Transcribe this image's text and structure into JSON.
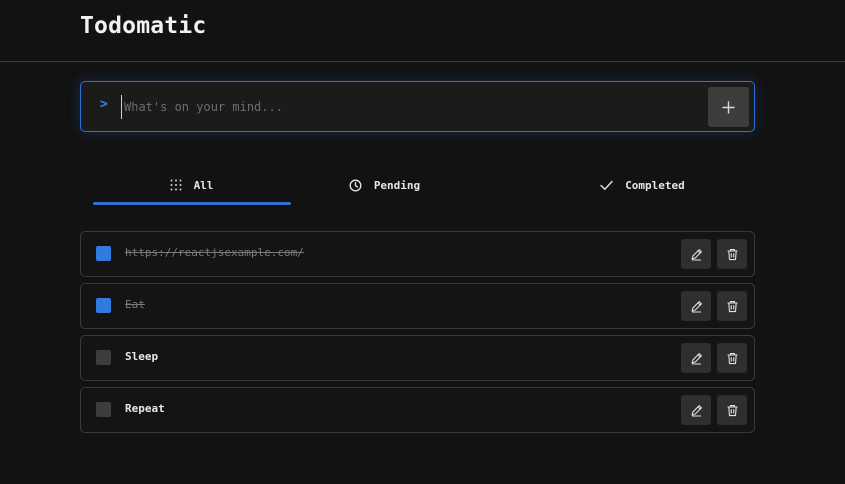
{
  "header": {
    "title": "Todomatic"
  },
  "input": {
    "prompt": ">",
    "placeholder": "What's on your mind..."
  },
  "tabs": [
    {
      "label": "All",
      "icon": "grid-dots-icon",
      "active": true
    },
    {
      "label": "Pending",
      "icon": "clock-icon",
      "active": false
    },
    {
      "label": "Completed",
      "icon": "check-icon",
      "active": false
    }
  ],
  "todos": [
    {
      "text": "https://reactjsexample.com/",
      "completed": true
    },
    {
      "text": "Eat",
      "completed": true
    },
    {
      "text": "Sleep",
      "completed": false
    },
    {
      "text": "Repeat",
      "completed": false
    }
  ],
  "colors": {
    "accent": "#2f6fd6",
    "background": "#121212",
    "checkbox_checked": "#2f7be0"
  }
}
